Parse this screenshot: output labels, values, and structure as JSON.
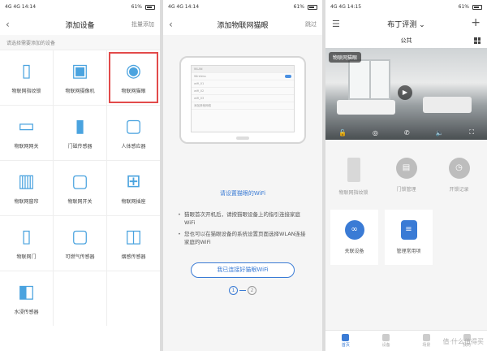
{
  "status": {
    "p1": {
      "left": "4G 4G 14:14",
      "right": "61%"
    },
    "p2": {
      "left": "4G 4G 14:14",
      "right": "61%"
    },
    "p3": {
      "left": "4G 4G 14:15",
      "right": "61%"
    }
  },
  "panel1": {
    "title": "添加设备",
    "action": "批量添加",
    "hint": "请选择需要添加的设备",
    "devices": [
      {
        "label": "物联网指纹锁",
        "icon": "fingerprint-lock-icon"
      },
      {
        "label": "物联网摄像机",
        "icon": "camera-icon"
      },
      {
        "label": "物联网猫眼",
        "icon": "peephole-icon",
        "selected": true
      },
      {
        "label": "物联网网关",
        "icon": "gateway-icon"
      },
      {
        "label": "门磁传感器",
        "icon": "door-sensor-icon"
      },
      {
        "label": "人体感应器",
        "icon": "motion-sensor-icon"
      },
      {
        "label": "物联网窗帘",
        "icon": "curtain-icon"
      },
      {
        "label": "物联网开关",
        "icon": "switch-icon"
      },
      {
        "label": "物联网插座",
        "icon": "socket-icon"
      },
      {
        "label": "物联网门",
        "icon": "door-icon"
      },
      {
        "label": "可燃气传感器",
        "icon": "gas-sensor-icon"
      },
      {
        "label": "烟感传感器",
        "icon": "smoke-sensor-icon"
      },
      {
        "label": "水浸传感器",
        "icon": "water-sensor-icon"
      }
    ]
  },
  "panel2": {
    "title": "添加物联网猫眼",
    "action": "跳过",
    "tablet_header": "WLAN",
    "wifi_rows": [
      "Wireless",
      "wifi_01",
      "wifi_02",
      "wifi_03",
      "添加其他网络"
    ],
    "link": "请设置猫眼的WiFi",
    "tips": [
      "猫眼首次开机后，请按猫眼设备上的指引连接家庭WiFi",
      "您也可以在猫眼设备的系统设置页面选择WLAN连接家庭的WiFi"
    ],
    "button": "我已连接好猫眼WiFi",
    "steps": [
      "1",
      "2"
    ]
  },
  "panel3": {
    "title": "布丁评测",
    "subtitle": "公共",
    "cam_tag": "物联网猫眼",
    "row1": [
      {
        "label": "物联网指纹锁",
        "icon": "lock-icon"
      },
      {
        "label": "门锁管理",
        "icon": "lock-manage-icon"
      },
      {
        "label": "开锁记录",
        "icon": "clock-icon"
      }
    ],
    "row2": [
      {
        "label": "关联设备",
        "icon": "link-icon"
      },
      {
        "label": "管理常用项",
        "icon": "manage-icon"
      }
    ],
    "tabs": [
      {
        "label": "首页",
        "active": true
      },
      {
        "label": "设备",
        "active": false
      },
      {
        "label": "场景",
        "active": false
      },
      {
        "label": "我的",
        "active": false
      }
    ],
    "watermark": "值·什么值得买"
  },
  "colors": {
    "accent": "#3a7bd5",
    "selected_border": "#e24a4a"
  }
}
